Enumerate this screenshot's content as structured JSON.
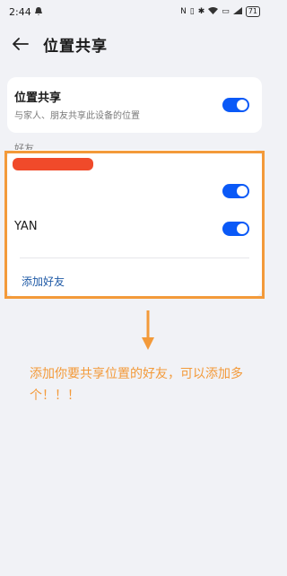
{
  "status_bar": {
    "time": "2:44",
    "battery": "71",
    "icons": [
      "notification-icon",
      "nfc-icon",
      "vibrate-icon",
      "bluetooth-icon",
      "wifi-icon",
      "sim-icon",
      "signal-icon",
      "battery-icon"
    ]
  },
  "header": {
    "title": "位置共享"
  },
  "location_share": {
    "title": "位置共享",
    "subtitle": "与家人、朋友共享此设备的位置",
    "enabled": true
  },
  "friends_section": {
    "label": "好友",
    "friends": [
      {
        "name": "",
        "enabled": true,
        "redacted": true
      },
      {
        "name": "YAN",
        "enabled": true
      }
    ],
    "add_friend": "添加好友"
  },
  "annotation": {
    "text": "添加你要共享位置的好友，可以添加多个！！！"
  },
  "colors": {
    "accent": "#0a59f7",
    "annotation": "#f39a3a",
    "link": "#1f5aa6",
    "redaction": "#f04a2a"
  }
}
